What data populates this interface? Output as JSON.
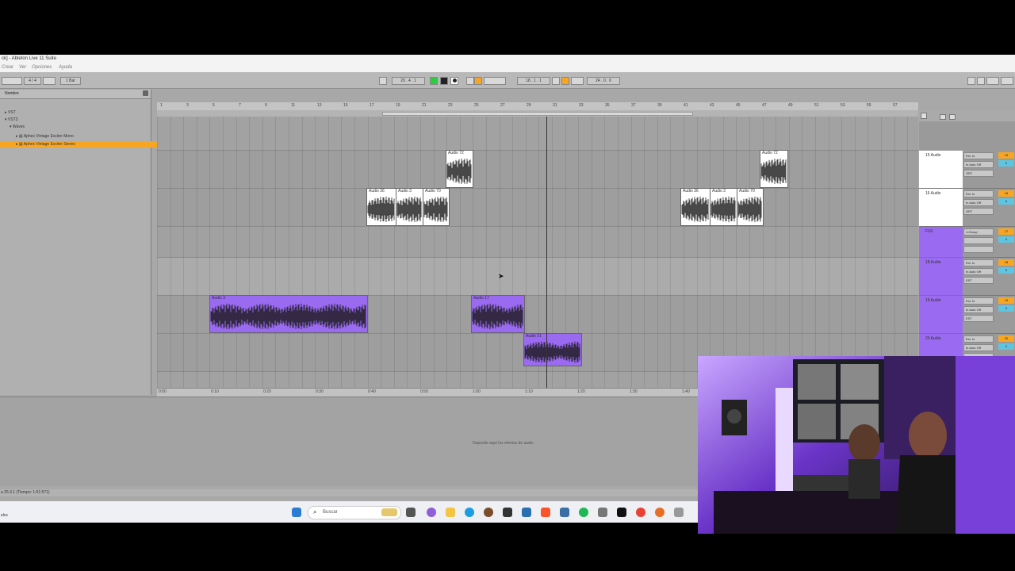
{
  "window": {
    "title": "ck] - Ableton Live 11 Suite"
  },
  "menu": [
    "Crear",
    "Ver",
    "Opciones",
    "Ayuda"
  ],
  "transport": {
    "time_signature": "4 / 4",
    "quantize": "1 Bar",
    "tempo": "",
    "position": "20 .  4 .  1",
    "loop_start": "18 .  1 .  1",
    "loop_length": "24 .  0 .  0"
  },
  "browser": {
    "header": "Nombre",
    "items": [
      "VST",
      "VST3",
      "Waves",
      "Aphex Vintage Exciter Mono",
      "Aphex Vintage Exciter Stereo"
    ],
    "selected_index": 4
  },
  "ruler": {
    "bars": [
      "1",
      "3",
      "5",
      "7",
      "9",
      "11",
      "13",
      "15",
      "17",
      "19",
      "21",
      "23",
      "25",
      "27",
      "29",
      "31",
      "33",
      "35",
      "37",
      "39",
      "41",
      "43",
      "45",
      "47",
      "49",
      "51",
      "53",
      "55",
      "57"
    ]
  },
  "timeline": {
    "times": [
      "0:00",
      "0:10",
      "0:20",
      "0:30",
      "0:40",
      "0:50",
      "1:00",
      "1:10",
      "1:20",
      "1:30",
      "1:40"
    ]
  },
  "clips": [
    {
      "name": "Audio 72",
      "color": "#ffffff",
      "track": 1
    },
    {
      "name": "Audio 72",
      "color": "#ffffff",
      "track": 1
    },
    {
      "name": "Audio 36",
      "color": "#ffffff",
      "track": 2
    },
    {
      "name": "Audio 3",
      "color": "#ffffff",
      "track": 2
    },
    {
      "name": "Audio 70",
      "color": "#ffffff",
      "track": 2
    },
    {
      "name": "Audio 36",
      "color": "#ffffff",
      "track": 2
    },
    {
      "name": "Audio 3",
      "color": "#ffffff",
      "track": 2
    },
    {
      "name": "Audio 70",
      "color": "#ffffff",
      "track": 2
    },
    {
      "name": "Audio 3",
      "color": "#9a6af0",
      "track": 5
    },
    {
      "name": "Audio 17",
      "color": "#9a6af0",
      "track": 5
    },
    {
      "name": "Audio 21",
      "color": "#9a6af0",
      "track": 6
    }
  ],
  "mixer": {
    "tracks": [
      {
        "name": "15 Audio",
        "input": "Ext. In",
        "monitor": "In Auto Off",
        "output": "GR7",
        "number": "15",
        "volume": "0",
        "color": "#ffffff"
      },
      {
        "name": "16 Audio",
        "input": "Ext. In",
        "monitor": "In Auto Off",
        "output": "GR7",
        "number": "16",
        "volume": "0",
        "color": "#ffffff"
      },
      {
        "name": "FX6",
        "input": "1-Group",
        "monitor": "",
        "output": "",
        "number": "17",
        "volume": "0",
        "color": "#9a6af0"
      },
      {
        "name": "18 Audio",
        "input": "Ext. In",
        "monitor": "In Auto Off",
        "output": "EST",
        "number": "18",
        "volume": "0",
        "color": "#9a6af0"
      },
      {
        "name": "19 Audio",
        "input": "Ext. In",
        "monitor": "In Auto Off",
        "output": "EST",
        "number": "19",
        "volume": "0",
        "color": "#9a6af0"
      },
      {
        "name": "20 Audio",
        "input": "Ext. In",
        "monitor": "In Auto Off",
        "output": "",
        "number": "20",
        "volume": "0",
        "color": "#9a6af0"
      }
    ]
  },
  "detail": {
    "drop_hint": "Deposite aquí los efectos de audio"
  },
  "status": {
    "text": "a 25.3.1 (Tiempo: 1:01:571)"
  },
  "taskbar": {
    "search_placeholder": "Buscar",
    "left_label": "elec"
  },
  "colors": {
    "accent_orange": "#f6a623",
    "clip_purple": "#9a6af0",
    "meter_blue": "#5fc4e0",
    "play_green": "#2ecc40"
  },
  "icons": [
    "windows-start-icon",
    "search-icon",
    "task-view-icon",
    "chrome-icon",
    "folder-icon",
    "edge-icon",
    "brave-icon",
    "spotify-icon",
    "ableton-icon"
  ]
}
